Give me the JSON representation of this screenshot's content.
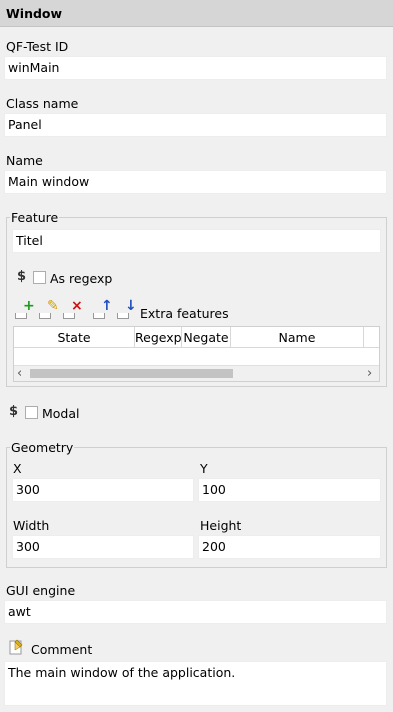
{
  "header": {
    "title": "Window"
  },
  "qftest_id": {
    "label": "QF-Test ID",
    "value": "winMain"
  },
  "class_name": {
    "label": "Class name",
    "value": "Panel"
  },
  "name": {
    "label": "Name",
    "value": "Main window"
  },
  "feature": {
    "legend": "Feature",
    "value": "Titel",
    "regexp_label": "As regexp",
    "dollar": "$",
    "extra_features_label": "Extra features",
    "toolbar_icons": [
      "add-icon",
      "edit-icon",
      "delete-icon",
      "move-up-icon",
      "move-down-icon"
    ],
    "table_columns": [
      "State",
      "Regexp",
      "Negate",
      "Name"
    ],
    "scroll_left": "‹",
    "scroll_right": "›"
  },
  "modal": {
    "dollar": "$",
    "label": "Modal"
  },
  "geometry": {
    "legend": "Geometry",
    "x_label": "X",
    "x_value": "300",
    "y_label": "Y",
    "y_value": "100",
    "width_label": "Width",
    "width_value": "300",
    "height_label": "Height",
    "height_value": "200"
  },
  "gui_engine": {
    "label": "GUI engine",
    "value": "awt"
  },
  "comment": {
    "label": "Comment",
    "value": "The main window of the application."
  }
}
